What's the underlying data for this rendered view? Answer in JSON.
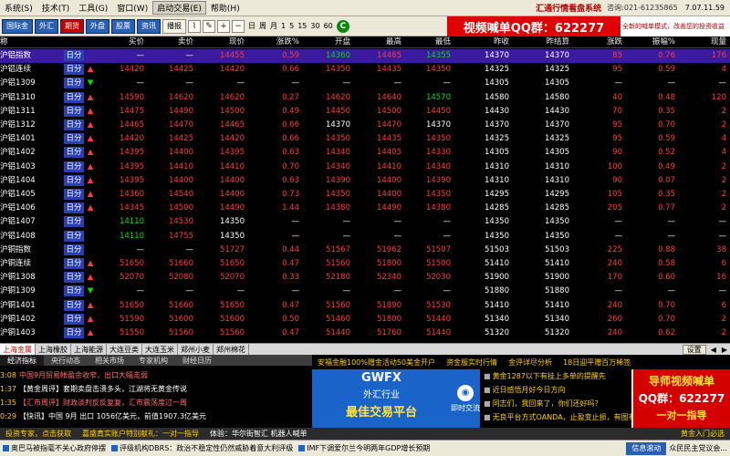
{
  "menu": {
    "items": [
      "系统(S)",
      "技术(T)",
      "工具(G)",
      "窗口(W)",
      "启动交易(E)",
      "帮助(H)"
    ],
    "brand": "汇通行情看盘系统",
    "phone": "咨询:021-61235865",
    "version": "7.07.11.59"
  },
  "toolbar": {
    "buttons": [
      {
        "label": "国际金",
        "style": "blue"
      },
      {
        "label": "外汇",
        "style": "blue"
      },
      {
        "label": "期货",
        "style": "red"
      },
      {
        "label": "外盘",
        "style": "blue"
      },
      {
        "label": "股票",
        "style": "blue"
      },
      {
        "label": "资讯",
        "style": "blue"
      },
      {
        "label": "播报",
        "style": "light"
      }
    ],
    "periods": [
      "日",
      "周",
      "月",
      "1",
      "5",
      "15",
      "30",
      "60"
    ],
    "qq_banner": "视频喊单QQ群：622277",
    "qq_side": "全新的喊单模式，改善您的投资收益"
  },
  "table": {
    "headers": {
      "name": "称",
      "buy": "买价",
      "sell": "卖价",
      "current": "现价",
      "change": "涨跌%",
      "open": "开盘",
      "high": "最高",
      "low": "最低",
      "prev_close": "昨收",
      "prev_settle": "昨结算",
      "diff": "涨跌",
      "amplitude": "振幅%",
      "volume": "现量"
    },
    "rows": [
      {
        "name": "沪铝指数",
        "period": "日分",
        "arrow": "",
        "arrow_color": "",
        "buy": "—",
        "sell": "—",
        "cur": "14455",
        "chg": "0.59",
        "open": "14360",
        "high": "14465",
        "low": "14355",
        "prev": "14370",
        "pset": "14370",
        "diff": "85",
        "amp": "0.76",
        "vol": "176",
        "buy_c": "wh",
        "sell_c": "wh",
        "cur_c": "up",
        "chg_c": "up",
        "open_c": "dn",
        "high_c": "up",
        "low_c": "dn",
        "diff_c": "up",
        "amp_c": "up",
        "vol_c": "up",
        "selected": true
      },
      {
        "name": "沪铝连续",
        "period": "日分",
        "arrow": "▲",
        "arrow_color": "up",
        "buy": "14420",
        "sell": "14425",
        "cur": "14420",
        "chg": "0.66",
        "open": "14350",
        "high": "14435",
        "low": "14350",
        "prev": "14325",
        "pset": "14325",
        "diff": "95",
        "amp": "0.59",
        "vol": "4",
        "buy_c": "up",
        "sell_c": "up",
        "cur_c": "up",
        "chg_c": "up",
        "open_c": "up",
        "high_c": "up",
        "low_c": "up",
        "diff_c": "up",
        "amp_c": "up",
        "vol_c": "up"
      },
      {
        "name": "沪铝1309",
        "period": "日分",
        "arrow": "▼",
        "arrow_color": "dn",
        "buy": "—",
        "sell": "—",
        "cur": "—",
        "chg": "—",
        "open": "—",
        "high": "—",
        "low": "—",
        "prev": "14305",
        "pset": "14305",
        "diff": "—",
        "amp": "—",
        "vol": "—",
        "buy_c": "wh",
        "sell_c": "wh",
        "cur_c": "wh",
        "chg_c": "wh",
        "open_c": "wh",
        "high_c": "wh",
        "low_c": "wh",
        "diff_c": "wh",
        "amp_c": "wh",
        "vol_c": "wh"
      },
      {
        "name": "沪铝1310",
        "period": "日分",
        "arrow": "▲",
        "arrow_color": "up",
        "buy": "14590",
        "sell": "14620",
        "cur": "14620",
        "chg": "0.27",
        "open": "14620",
        "high": "14640",
        "low": "14570",
        "prev": "14580",
        "pset": "14580",
        "diff": "40",
        "amp": "0.48",
        "vol": "120",
        "buy_c": "up",
        "sell_c": "up",
        "cur_c": "up",
        "chg_c": "up",
        "open_c": "up",
        "high_c": "up",
        "low_c": "dn",
        "diff_c": "up",
        "amp_c": "up",
        "vol_c": "up"
      },
      {
        "name": "沪铝1311",
        "period": "日分",
        "arrow": "▲",
        "arrow_color": "up",
        "buy": "14475",
        "sell": "14490",
        "cur": "14500",
        "chg": "0.49",
        "open": "14450",
        "high": "14500",
        "low": "14450",
        "prev": "14430",
        "pset": "14430",
        "diff": "70",
        "amp": "0.35",
        "vol": "2",
        "buy_c": "up",
        "sell_c": "up",
        "cur_c": "up",
        "chg_c": "up",
        "open_c": "up",
        "high_c": "up",
        "low_c": "up",
        "diff_c": "up",
        "amp_c": "up",
        "vol_c": "up"
      },
      {
        "name": "沪铝1312",
        "period": "日分",
        "arrow": "▲",
        "arrow_color": "up",
        "buy": "14465",
        "sell": "14470",
        "cur": "14465",
        "chg": "0.66",
        "open": "14370",
        "high": "14470",
        "low": "14370",
        "prev": "14370",
        "pset": "14370",
        "diff": "95",
        "amp": "0.70",
        "vol": "2",
        "buy_c": "up",
        "sell_c": "up",
        "cur_c": "up",
        "chg_c": "up",
        "open_c": "wh",
        "high_c": "up",
        "low_c": "wh",
        "diff_c": "up",
        "amp_c": "up",
        "vol_c": "up"
      },
      {
        "name": "沪铝1401",
        "period": "日分",
        "arrow": "▲",
        "arrow_color": "up",
        "buy": "14420",
        "sell": "14425",
        "cur": "14420",
        "chg": "0.66",
        "open": "14350",
        "high": "14435",
        "low": "14350",
        "prev": "14325",
        "pset": "14325",
        "diff": "95",
        "amp": "0.59",
        "vol": "4",
        "buy_c": "up",
        "sell_c": "up",
        "cur_c": "up",
        "chg_c": "up",
        "open_c": "up",
        "high_c": "up",
        "low_c": "up",
        "diff_c": "up",
        "amp_c": "up",
        "vol_c": "up"
      },
      {
        "name": "沪铝1402",
        "period": "日分",
        "arrow": "▲",
        "arrow_color": "up",
        "buy": "14395",
        "sell": "14400",
        "cur": "14395",
        "chg": "0.63",
        "open": "14340",
        "high": "14405",
        "low": "14330",
        "prev": "14305",
        "pset": "14305",
        "diff": "90",
        "amp": "0.52",
        "vol": "4",
        "buy_c": "up",
        "sell_c": "up",
        "cur_c": "up",
        "chg_c": "up",
        "open_c": "up",
        "high_c": "up",
        "low_c": "up",
        "diff_c": "up",
        "amp_c": "up",
        "vol_c": "up"
      },
      {
        "name": "沪铝1403",
        "period": "日分",
        "arrow": "▲",
        "arrow_color": "up",
        "buy": "14395",
        "sell": "14410",
        "cur": "14410",
        "chg": "0.70",
        "open": "14340",
        "high": "14410",
        "low": "14340",
        "prev": "14310",
        "pset": "14310",
        "diff": "100",
        "amp": "0.49",
        "vol": "2",
        "buy_c": "up",
        "sell_c": "up",
        "cur_c": "up",
        "chg_c": "up",
        "open_c": "up",
        "high_c": "up",
        "low_c": "up",
        "diff_c": "up",
        "amp_c": "up",
        "vol_c": "up"
      },
      {
        "name": "沪铝1404",
        "period": "日分",
        "arrow": "▲",
        "arrow_color": "up",
        "buy": "14395",
        "sell": "14400",
        "cur": "14400",
        "chg": "0.63",
        "open": "14390",
        "high": "14400",
        "low": "14390",
        "prev": "14310",
        "pset": "14310",
        "diff": "90",
        "amp": "0.07",
        "vol": "2",
        "buy_c": "up",
        "sell_c": "up",
        "cur_c": "up",
        "chg_c": "up",
        "open_c": "up",
        "high_c": "up",
        "low_c": "up",
        "diff_c": "up",
        "amp_c": "up",
        "vol_c": "up"
      },
      {
        "name": "沪铝1405",
        "period": "日分",
        "arrow": "▲",
        "arrow_color": "up",
        "buy": "14360",
        "sell": "14540",
        "cur": "14400",
        "chg": "0.73",
        "open": "14350",
        "high": "14400",
        "low": "14350",
        "prev": "14295",
        "pset": "14295",
        "diff": "105",
        "amp": "0.35",
        "vol": "2",
        "buy_c": "up",
        "sell_c": "up",
        "cur_c": "up",
        "chg_c": "up",
        "open_c": "up",
        "high_c": "up",
        "low_c": "up",
        "diff_c": "up",
        "amp_c": "up",
        "vol_c": "up"
      },
      {
        "name": "沪铝1406",
        "period": "日分",
        "arrow": "▲",
        "arrow_color": "up",
        "buy": "14345",
        "sell": "14500",
        "cur": "14490",
        "chg": "1.44",
        "open": "14380",
        "high": "14490",
        "low": "14380",
        "prev": "14285",
        "pset": "14285",
        "diff": "205",
        "amp": "0.77",
        "vol": "2",
        "buy_c": "up",
        "sell_c": "up",
        "cur_c": "up",
        "chg_c": "up",
        "open_c": "up",
        "high_c": "up",
        "low_c": "up",
        "diff_c": "up",
        "amp_c": "up",
        "vol_c": "up"
      },
      {
        "name": "沪铝1407",
        "period": "日分",
        "arrow": "",
        "arrow_color": "",
        "buy": "14110",
        "sell": "14530",
        "cur": "14350",
        "chg": "—",
        "open": "—",
        "high": "—",
        "low": "—",
        "prev": "14350",
        "pset": "14350",
        "diff": "—",
        "amp": "—",
        "vol": "—",
        "buy_c": "dn",
        "sell_c": "up",
        "cur_c": "wh",
        "chg_c": "wh",
        "open_c": "wh",
        "high_c": "wh",
        "low_c": "wh",
        "diff_c": "wh",
        "amp_c": "wh",
        "vol_c": "wh"
      },
      {
        "name": "沪铝1408",
        "period": "日分",
        "arrow": "",
        "arrow_color": "",
        "buy": "14110",
        "sell": "14755",
        "cur": "14350",
        "chg": "—",
        "open": "—",
        "high": "—",
        "low": "—",
        "prev": "14350",
        "pset": "14350",
        "diff": "—",
        "amp": "—",
        "vol": "—",
        "buy_c": "dn",
        "sell_c": "up",
        "cur_c": "wh",
        "chg_c": "wh",
        "open_c": "wh",
        "high_c": "wh",
        "low_c": "wh",
        "diff_c": "wh",
        "amp_c": "wh",
        "vol_c": "wh"
      },
      {
        "name": "沪铜指数",
        "period": "日分",
        "arrow": "",
        "arrow_color": "",
        "buy": "—",
        "sell": "—",
        "cur": "51727",
        "chg": "0.44",
        "open": "51567",
        "high": "51962",
        "low": "51507",
        "prev": "51503",
        "pset": "51503",
        "diff": "225",
        "amp": "0.88",
        "vol": "38",
        "buy_c": "wh",
        "sell_c": "wh",
        "cur_c": "up",
        "chg_c": "up",
        "open_c": "up",
        "high_c": "up",
        "low_c": "up",
        "diff_c": "up",
        "amp_c": "up",
        "vol_c": "up"
      },
      {
        "name": "沪铜连续",
        "period": "日分",
        "arrow": "▲",
        "arrow_color": "up",
        "buy": "51650",
        "sell": "51660",
        "cur": "51650",
        "chg": "0.47",
        "open": "51560",
        "high": "51800",
        "low": "51500",
        "prev": "51410",
        "pset": "51410",
        "diff": "240",
        "amp": "0.58",
        "vol": "6",
        "buy_c": "up",
        "sell_c": "up",
        "cur_c": "up",
        "chg_c": "up",
        "open_c": "up",
        "high_c": "up",
        "low_c": "up",
        "diff_c": "up",
        "amp_c": "up",
        "vol_c": "up"
      },
      {
        "name": "沪铜1308",
        "period": "日分",
        "arrow": "▲",
        "arrow_color": "up",
        "buy": "52070",
        "sell": "52080",
        "cur": "52070",
        "chg": "0.33",
        "open": "52180",
        "high": "52340",
        "low": "52030",
        "prev": "51900",
        "pset": "51900",
        "diff": "170",
        "amp": "0.60",
        "vol": "16",
        "buy_c": "up",
        "sell_c": "up",
        "cur_c": "up",
        "chg_c": "up",
        "open_c": "up",
        "high_c": "up",
        "low_c": "up",
        "diff_c": "up",
        "amp_c": "up",
        "vol_c": "up"
      },
      {
        "name": "沪铜1309",
        "period": "日分",
        "arrow": "▼",
        "arrow_color": "dn",
        "buy": "—",
        "sell": "—",
        "cur": "—",
        "chg": "—",
        "open": "—",
        "high": "—",
        "low": "—",
        "prev": "51880",
        "pset": "51880",
        "diff": "—",
        "amp": "—",
        "vol": "—",
        "buy_c": "wh",
        "sell_c": "wh",
        "cur_c": "wh",
        "chg_c": "wh",
        "open_c": "wh",
        "high_c": "wh",
        "low_c": "wh",
        "diff_c": "wh",
        "amp_c": "wh",
        "vol_c": "wh"
      },
      {
        "name": "沪铜1401",
        "period": "日分",
        "arrow": "▲",
        "arrow_color": "up",
        "buy": "51650",
        "sell": "51660",
        "cur": "51650",
        "chg": "0.47",
        "open": "51560",
        "high": "51890",
        "low": "51530",
        "prev": "51410",
        "pset": "51410",
        "diff": "240",
        "amp": "0.70",
        "vol": "6",
        "buy_c": "up",
        "sell_c": "up",
        "cur_c": "up",
        "chg_c": "up",
        "open_c": "up",
        "high_c": "up",
        "low_c": "up",
        "diff_c": "up",
        "amp_c": "up",
        "vol_c": "up"
      },
      {
        "name": "沪铜1402",
        "period": "日分",
        "arrow": "▲",
        "arrow_color": "up",
        "buy": "51590",
        "sell": "51600",
        "cur": "51600",
        "chg": "0.50",
        "open": "51460",
        "high": "51800",
        "low": "51440",
        "prev": "51340",
        "pset": "51340",
        "diff": "260",
        "amp": "0.70",
        "vol": "2",
        "buy_c": "up",
        "sell_c": "up",
        "cur_c": "up",
        "chg_c": "up",
        "open_c": "up",
        "high_c": "up",
        "low_c": "up",
        "diff_c": "up",
        "amp_c": "up",
        "vol_c": "up"
      },
      {
        "name": "沪铜1403",
        "period": "日分",
        "arrow": "▲",
        "arrow_color": "up",
        "buy": "51550",
        "sell": "51560",
        "cur": "51560",
        "chg": "0.47",
        "open": "51440",
        "high": "51760",
        "low": "51440",
        "prev": "51320",
        "pset": "51320",
        "diff": "240",
        "amp": "0.62",
        "vol": "2",
        "buy_c": "up",
        "sell_c": "up",
        "cur_c": "up",
        "chg_c": "up",
        "open_c": "up",
        "high_c": "up",
        "low_c": "up",
        "diff_c": "up",
        "amp_c": "up",
        "vol_c": "up"
      }
    ]
  },
  "market_tabs": {
    "items": [
      "上海金属",
      "上海橡胶",
      "上海能源",
      "大连豆类",
      "大连玉米",
      "郑州小麦",
      "郑州棉花"
    ],
    "active": 0,
    "settings_label": "设置"
  },
  "news": {
    "tabs": [
      "经济指标",
      "央行动态",
      "相关市场",
      "专家机构",
      "财经日历"
    ],
    "items": [
      {
        "time": "3:08",
        "text": "中国9月贸易帐盈余收窄，出口大幅走弱",
        "hl": true
      },
      {
        "time": "1:37",
        "text": "【黄金周评】套期卖盘击溃多头，江湖将无黄金传说",
        "hl": false
      },
      {
        "time": "1:35",
        "text": "【汇市周评】财政谈判反反复复，汇市震荡度过一周",
        "hl": true
      },
      {
        "time": "0:29",
        "text": "【快讯】中国 9月 出口 1056亿美元，前值1907.3亿美元",
        "hl": false
      }
    ],
    "linkbar": [
      "投资专家，点击获取",
      "嘉盛真实账户特别献礼：一对一指导",
      "体验：华尔街智汇 机器人喊单"
    ]
  },
  "ads": {
    "gwfx_logo": "GWFX",
    "gwfx_line1": "外汇行业",
    "gwfx_line2": "最佳交易平台",
    "tick_label": "即时交流",
    "right_news": [
      "黄金1287以下有挂上多单的提醒先",
      "近日感悟月好今日方向",
      "同志们，我回来了，你们还好吗？",
      "无良平台方式OANDA，止盈变止损，有图有"
    ],
    "right_top": [
      "安福金融100%赠金活动50美金开户",
      "资金服实时行情",
      "金评详尽分析",
      "18日迎平赠百万稀签"
    ],
    "mentor_l1": "导师视频喊单",
    "mentor_l2": "QQ群：622277",
    "mentor_l3": "一对一指导",
    "news_rt": "黄金入门必选"
  },
  "ticker": {
    "items": [
      "奥巴马被指毫不关心政府停摆",
      "评级机构DBRS：政治不稳定性仍然威胁着意大利评级",
      "IMF下调爱尔兰今明两年GDP增长预期",
      "众民主党议会..."
    ],
    "info": "信息滚动",
    "info2": "众民民主党议会..."
  }
}
